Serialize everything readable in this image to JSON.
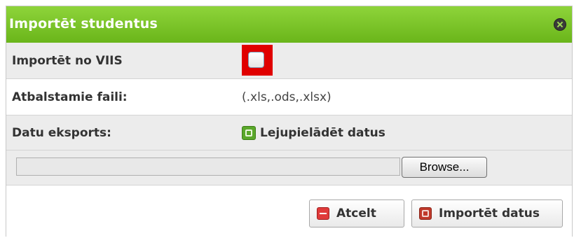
{
  "dialog": {
    "title": "Importēt studentus",
    "close_icon": "close-icon",
    "accent_color": "#79c62a"
  },
  "rows": {
    "import_viis": {
      "label": "Importēt no VIIS",
      "checked": false
    },
    "supported_files": {
      "label": "Atbalstamie faili:",
      "value": "(.xls,.ods,.xlsx)"
    },
    "data_export": {
      "label": "Datu eksports:",
      "link_label": "Lejupielādēt datus",
      "icon": "download-icon"
    }
  },
  "file_upload": {
    "value": "",
    "browse_label": "Browse..."
  },
  "actions": {
    "cancel_label": "Atcelt",
    "import_label": "Importēt datus"
  }
}
